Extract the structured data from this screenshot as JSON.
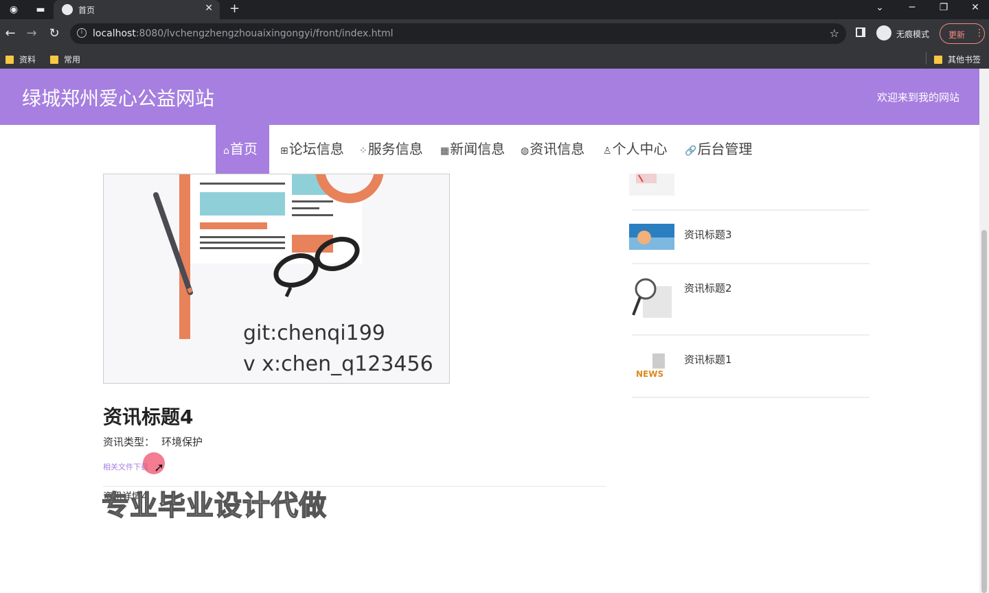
{
  "browser": {
    "tab_title": "首页",
    "url_host": "localhost",
    "url_rest": ":8080/lvchengzhengzhouaixingongyi/front/index.html",
    "incognito_label": "无痕模式",
    "update_label": "更新",
    "bookmarks": [
      "资料",
      "常用"
    ],
    "other_bookmarks": "其他书签"
  },
  "site": {
    "title": "绿城郑州爱心公益网站",
    "welcome": "欢迎来到我的网站"
  },
  "nav": [
    {
      "icon": "⌂",
      "label": "首页",
      "active": true
    },
    {
      "icon": "⊞",
      "label": "论坛信息"
    },
    {
      "icon": "⁘",
      "label": "服务信息"
    },
    {
      "icon": "▦",
      "label": "新闻信息"
    },
    {
      "icon": "◍",
      "label": "资讯信息"
    },
    {
      "icon": "♙",
      "label": "个人中心"
    },
    {
      "icon": "🔗",
      "label": "后台管理"
    }
  ],
  "article": {
    "image_text_1": "git:chenqi199",
    "image_text_2": "v x:chen_q123456",
    "title": "资讯标题4",
    "type_label": "资讯类型：",
    "type_value": "环境保护",
    "download_label": "相关文件下载",
    "detail": "资讯详情4",
    "overlay": "专业毕业设计代做"
  },
  "sidebar_news": [
    {
      "title": "资讯标题3",
      "thumb": "blue-thumb"
    },
    {
      "title": "资讯标题2",
      "thumb": "magnifier-thumb"
    },
    {
      "title": "资讯标题1",
      "thumb": "news-thumb"
    }
  ],
  "colors": {
    "accent": "#a67fe0",
    "chrome_dark": "#202124",
    "chrome_mid": "#35363a"
  }
}
